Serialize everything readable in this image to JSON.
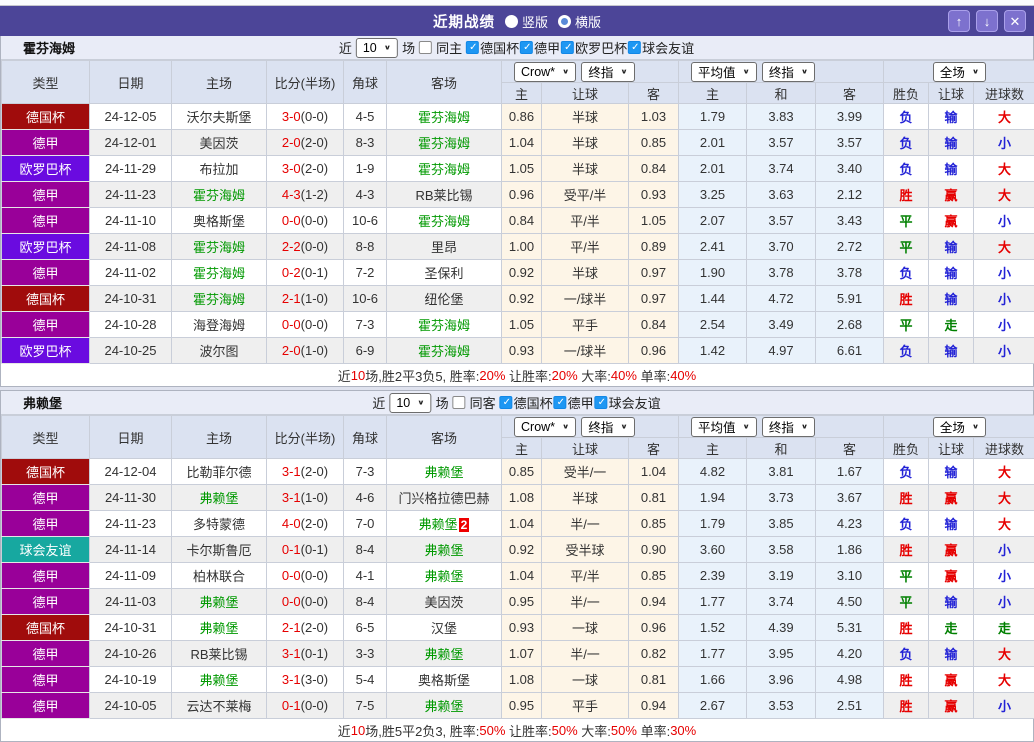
{
  "titlebar": {
    "title": "近期战绩",
    "radios": [
      {
        "label": "竖版",
        "style": "filled"
      },
      {
        "label": "横版",
        "style": "ring"
      }
    ],
    "buttons": [
      {
        "name": "scroll-up-button",
        "icon": "arrow-up-icon",
        "glyph": "↑"
      },
      {
        "name": "scroll-down-button",
        "icon": "arrow-down-icon",
        "glyph": "↓"
      },
      {
        "name": "close-button",
        "icon": "close-icon",
        "glyph": "✕"
      }
    ]
  },
  "colors": {
    "titlebar_bg": "#4c4598",
    "checkbox_blue": "#1e97f3",
    "team_green": "#009900",
    "score_red": "#e60000"
  },
  "league_colors": {
    "德国杯": "#a00c0c",
    "德甲": "#990099",
    "欧罗巴杯": "#6a0be0",
    "球会友谊": "#17a8a0"
  },
  "result_colors": {
    "r": "#e60000",
    "b": "#2323d6",
    "g": "#008000"
  },
  "table_header": {
    "cols": [
      "类型",
      "日期",
      "主场",
      "比分(半场)",
      "角球",
      "客场"
    ],
    "groups": [
      {
        "selects": [
          "Crow*",
          "终指"
        ],
        "subs": [
          "主",
          "让球",
          "客"
        ],
        "align": "left"
      },
      {
        "selects": [
          "平均值",
          "终指"
        ],
        "subs": [
          "主",
          "和",
          "客"
        ],
        "align": "left"
      },
      {
        "selects": [
          "全场"
        ],
        "subs": [
          "胜负",
          "让球",
          "进球数"
        ],
        "align": "center"
      }
    ]
  },
  "sections": [
    {
      "team": "霍芬海姆",
      "filter": {
        "near_label": "近",
        "count": "10",
        "games_label": "场",
        "same_label": "同主",
        "leagues": [
          "德国杯",
          "德甲",
          "欧罗巴杯",
          "球会友谊"
        ]
      },
      "rows": [
        {
          "league": "德国杯",
          "date": "24-12-05",
          "home": {
            "t": "沃尔夫斯堡",
            "green": false
          },
          "score": {
            "ft": "3-0",
            "ht": "(0-0)"
          },
          "corner": "4-5",
          "away": {
            "t": "霍芬海姆",
            "green": true
          },
          "odds": [
            "0.86",
            "半球",
            "1.03"
          ],
          "avg": [
            "1.79",
            "3.83",
            "3.99"
          ],
          "results": [
            {
              "t": "负",
              "c": "b"
            },
            {
              "t": "输",
              "c": "b"
            },
            {
              "t": "大",
              "c": "r"
            }
          ]
        },
        {
          "league": "德甲",
          "date": "24-12-01",
          "home": {
            "t": "美因茨",
            "green": false
          },
          "score": {
            "ft": "2-0",
            "ht": "(2-0)"
          },
          "corner": "8-3",
          "away": {
            "t": "霍芬海姆",
            "green": true
          },
          "odds": [
            "1.04",
            "半球",
            "0.85"
          ],
          "avg": [
            "2.01",
            "3.57",
            "3.57"
          ],
          "results": [
            {
              "t": "负",
              "c": "b"
            },
            {
              "t": "输",
              "c": "b"
            },
            {
              "t": "小",
              "c": "b"
            }
          ]
        },
        {
          "league": "欧罗巴杯",
          "date": "24-11-29",
          "home": {
            "t": "布拉加",
            "green": false
          },
          "score": {
            "ft": "3-0",
            "ht": "(2-0)"
          },
          "corner": "1-9",
          "away": {
            "t": "霍芬海姆",
            "green": true
          },
          "odds": [
            "1.05",
            "半球",
            "0.84"
          ],
          "avg": [
            "2.01",
            "3.74",
            "3.40"
          ],
          "results": [
            {
              "t": "负",
              "c": "b"
            },
            {
              "t": "输",
              "c": "b"
            },
            {
              "t": "大",
              "c": "r"
            }
          ]
        },
        {
          "league": "德甲",
          "date": "24-11-23",
          "home": {
            "t": "霍芬海姆",
            "green": true
          },
          "score": {
            "ft": "4-3",
            "ht": "(1-2)"
          },
          "corner": "4-3",
          "away": {
            "t": "RB莱比锡",
            "green": false
          },
          "odds": [
            "0.96",
            "受平/半",
            "0.93"
          ],
          "avg": [
            "3.25",
            "3.63",
            "2.12"
          ],
          "results": [
            {
              "t": "胜",
              "c": "r"
            },
            {
              "t": "赢",
              "c": "r"
            },
            {
              "t": "大",
              "c": "r"
            }
          ]
        },
        {
          "league": "德甲",
          "date": "24-11-10",
          "home": {
            "t": "奥格斯堡",
            "green": false
          },
          "score": {
            "ft": "0-0",
            "ht": "(0-0)"
          },
          "corner": "10-6",
          "away": {
            "t": "霍芬海姆",
            "green": true
          },
          "odds": [
            "0.84",
            "平/半",
            "1.05"
          ],
          "avg": [
            "2.07",
            "3.57",
            "3.43"
          ],
          "results": [
            {
              "t": "平",
              "c": "g"
            },
            {
              "t": "赢",
              "c": "r"
            },
            {
              "t": "小",
              "c": "b"
            }
          ]
        },
        {
          "league": "欧罗巴杯",
          "date": "24-11-08",
          "home": {
            "t": "霍芬海姆",
            "green": true
          },
          "score": {
            "ft": "2-2",
            "ht": "(0-0)"
          },
          "corner": "8-8",
          "away": {
            "t": "里昂",
            "green": false
          },
          "odds": [
            "1.00",
            "平/半",
            "0.89"
          ],
          "avg": [
            "2.41",
            "3.70",
            "2.72"
          ],
          "results": [
            {
              "t": "平",
              "c": "g"
            },
            {
              "t": "输",
              "c": "b"
            },
            {
              "t": "大",
              "c": "r"
            }
          ]
        },
        {
          "league": "德甲",
          "date": "24-11-02",
          "home": {
            "t": "霍芬海姆",
            "green": true
          },
          "score": {
            "ft": "0-2",
            "ht": "(0-1)"
          },
          "corner": "7-2",
          "away": {
            "t": "圣保利",
            "green": false
          },
          "odds": [
            "0.92",
            "半球",
            "0.97"
          ],
          "avg": [
            "1.90",
            "3.78",
            "3.78"
          ],
          "results": [
            {
              "t": "负",
              "c": "b"
            },
            {
              "t": "输",
              "c": "b"
            },
            {
              "t": "小",
              "c": "b"
            }
          ]
        },
        {
          "league": "德国杯",
          "date": "24-10-31",
          "home": {
            "t": "霍芬海姆",
            "green": true
          },
          "score": {
            "ft": "2-1",
            "ht": "(1-0)"
          },
          "corner": "10-6",
          "away": {
            "t": "纽伦堡",
            "green": false
          },
          "odds": [
            "0.92",
            "一/球半",
            "0.97"
          ],
          "avg": [
            "1.44",
            "4.72",
            "5.91"
          ],
          "results": [
            {
              "t": "胜",
              "c": "r"
            },
            {
              "t": "输",
              "c": "b"
            },
            {
              "t": "小",
              "c": "b"
            }
          ]
        },
        {
          "league": "德甲",
          "date": "24-10-28",
          "home": {
            "t": "海登海姆",
            "green": false
          },
          "score": {
            "ft": "0-0",
            "ht": "(0-0)"
          },
          "corner": "7-3",
          "away": {
            "t": "霍芬海姆",
            "green": true
          },
          "odds": [
            "1.05",
            "平手",
            "0.84"
          ],
          "avg": [
            "2.54",
            "3.49",
            "2.68"
          ],
          "results": [
            {
              "t": "平",
              "c": "g"
            },
            {
              "t": "走",
              "c": "g"
            },
            {
              "t": "小",
              "c": "b"
            }
          ]
        },
        {
          "league": "欧罗巴杯",
          "date": "24-10-25",
          "home": {
            "t": "波尔图",
            "green": false
          },
          "score": {
            "ft": "2-0",
            "ht": "(1-0)"
          },
          "corner": "6-9",
          "away": {
            "t": "霍芬海姆",
            "green": true
          },
          "odds": [
            "0.93",
            "一/球半",
            "0.96"
          ],
          "avg": [
            "1.42",
            "4.97",
            "6.61"
          ],
          "results": [
            {
              "t": "负",
              "c": "b"
            },
            {
              "t": "输",
              "c": "b"
            },
            {
              "t": "小",
              "c": "b"
            }
          ]
        }
      ],
      "summary": [
        {
          "t": "近",
          "red": false
        },
        {
          "t": "10",
          "red": true
        },
        {
          "t": "场,胜2平3负5, 胜率:",
          "red": false
        },
        {
          "t": "20%",
          "red": true
        },
        {
          "t": " 让胜率:",
          "red": false
        },
        {
          "t": "20%",
          "red": true
        },
        {
          "t": " 大率:",
          "red": false
        },
        {
          "t": "40%",
          "red": true
        },
        {
          "t": " 单率:",
          "red": false
        },
        {
          "t": "40%",
          "red": true
        }
      ]
    },
    {
      "team": "弗赖堡",
      "filter": {
        "near_label": "近",
        "count": "10",
        "games_label": "场",
        "same_label": "同客",
        "leagues": [
          "德国杯",
          "德甲",
          "球会友谊"
        ]
      },
      "rows": [
        {
          "league": "德国杯",
          "date": "24-12-04",
          "home": {
            "t": "比勒菲尔德",
            "green": false
          },
          "score": {
            "ft": "3-1",
            "ht": "(2-0)"
          },
          "corner": "7-3",
          "away": {
            "t": "弗赖堡",
            "green": true
          },
          "odds": [
            "0.85",
            "受半/一",
            "1.04"
          ],
          "avg": [
            "4.82",
            "3.81",
            "1.67"
          ],
          "results": [
            {
              "t": "负",
              "c": "b"
            },
            {
              "t": "输",
              "c": "b"
            },
            {
              "t": "大",
              "c": "r"
            }
          ]
        },
        {
          "league": "德甲",
          "date": "24-11-30",
          "home": {
            "t": "弗赖堡",
            "green": true
          },
          "score": {
            "ft": "3-1",
            "ht": "(1-0)"
          },
          "corner": "4-6",
          "away": {
            "t": "门兴格拉德巴赫",
            "green": false
          },
          "odds": [
            "1.08",
            "半球",
            "0.81"
          ],
          "avg": [
            "1.94",
            "3.73",
            "3.67"
          ],
          "results": [
            {
              "t": "胜",
              "c": "r"
            },
            {
              "t": "赢",
              "c": "r"
            },
            {
              "t": "大",
              "c": "r"
            }
          ]
        },
        {
          "league": "德甲",
          "date": "24-11-23",
          "home": {
            "t": "多特蒙德",
            "green": false
          },
          "score": {
            "ft": "4-0",
            "ht": "(2-0)"
          },
          "corner": "7-0",
          "away": {
            "t": "弗赖堡",
            "green": true,
            "badge": "2"
          },
          "odds": [
            "1.04",
            "半/一",
            "0.85"
          ],
          "avg": [
            "1.79",
            "3.85",
            "4.23"
          ],
          "results": [
            {
              "t": "负",
              "c": "b"
            },
            {
              "t": "输",
              "c": "b"
            },
            {
              "t": "大",
              "c": "r"
            }
          ]
        },
        {
          "league": "球会友谊",
          "date": "24-11-14",
          "home": {
            "t": "卡尔斯鲁厄",
            "green": false
          },
          "score": {
            "ft": "0-1",
            "ht": "(0-1)"
          },
          "corner": "8-4",
          "away": {
            "t": "弗赖堡",
            "green": true
          },
          "odds": [
            "0.92",
            "受半球",
            "0.90"
          ],
          "avg": [
            "3.60",
            "3.58",
            "1.86"
          ],
          "results": [
            {
              "t": "胜",
              "c": "r"
            },
            {
              "t": "赢",
              "c": "r"
            },
            {
              "t": "小",
              "c": "b"
            }
          ]
        },
        {
          "league": "德甲",
          "date": "24-11-09",
          "home": {
            "t": "柏林联合",
            "green": false
          },
          "score": {
            "ft": "0-0",
            "ht": "(0-0)"
          },
          "corner": "4-1",
          "away": {
            "t": "弗赖堡",
            "green": true
          },
          "odds": [
            "1.04",
            "平/半",
            "0.85"
          ],
          "avg": [
            "2.39",
            "3.19",
            "3.10"
          ],
          "results": [
            {
              "t": "平",
              "c": "g"
            },
            {
              "t": "赢",
              "c": "r"
            },
            {
              "t": "小",
              "c": "b"
            }
          ]
        },
        {
          "league": "德甲",
          "date": "24-11-03",
          "home": {
            "t": "弗赖堡",
            "green": true
          },
          "score": {
            "ft": "0-0",
            "ht": "(0-0)"
          },
          "corner": "8-4",
          "away": {
            "t": "美因茨",
            "green": false
          },
          "odds": [
            "0.95",
            "半/一",
            "0.94"
          ],
          "avg": [
            "1.77",
            "3.74",
            "4.50"
          ],
          "results": [
            {
              "t": "平",
              "c": "g"
            },
            {
              "t": "输",
              "c": "b"
            },
            {
              "t": "小",
              "c": "b"
            }
          ]
        },
        {
          "league": "德国杯",
          "date": "24-10-31",
          "home": {
            "t": "弗赖堡",
            "green": true
          },
          "score": {
            "ft": "2-1",
            "ht": "(2-0)"
          },
          "corner": "6-5",
          "away": {
            "t": "汉堡",
            "green": false
          },
          "odds": [
            "0.93",
            "一球",
            "0.96"
          ],
          "avg": [
            "1.52",
            "4.39",
            "5.31"
          ],
          "results": [
            {
              "t": "胜",
              "c": "r"
            },
            {
              "t": "走",
              "c": "g"
            },
            {
              "t": "走",
              "c": "g"
            }
          ]
        },
        {
          "league": "德甲",
          "date": "24-10-26",
          "home": {
            "t": "RB莱比锡",
            "green": false
          },
          "score": {
            "ft": "3-1",
            "ht": "(0-1)"
          },
          "corner": "3-3",
          "away": {
            "t": "弗赖堡",
            "green": true
          },
          "odds": [
            "1.07",
            "半/一",
            "0.82"
          ],
          "avg": [
            "1.77",
            "3.95",
            "4.20"
          ],
          "results": [
            {
              "t": "负",
              "c": "b"
            },
            {
              "t": "输",
              "c": "b"
            },
            {
              "t": "大",
              "c": "r"
            }
          ]
        },
        {
          "league": "德甲",
          "date": "24-10-19",
          "home": {
            "t": "弗赖堡",
            "green": true
          },
          "score": {
            "ft": "3-1",
            "ht": "(3-0)"
          },
          "corner": "5-4",
          "away": {
            "t": "奥格斯堡",
            "green": false
          },
          "odds": [
            "1.08",
            "一球",
            "0.81"
          ],
          "avg": [
            "1.66",
            "3.96",
            "4.98"
          ],
          "results": [
            {
              "t": "胜",
              "c": "r"
            },
            {
              "t": "赢",
              "c": "r"
            },
            {
              "t": "大",
              "c": "r"
            }
          ]
        },
        {
          "league": "德甲",
          "date": "24-10-05",
          "home": {
            "t": "云达不莱梅",
            "green": false
          },
          "score": {
            "ft": "0-1",
            "ht": "(0-0)"
          },
          "corner": "7-5",
          "away": {
            "t": "弗赖堡",
            "green": true
          },
          "odds": [
            "0.95",
            "平手",
            "0.94"
          ],
          "avg": [
            "2.67",
            "3.53",
            "2.51"
          ],
          "results": [
            {
              "t": "胜",
              "c": "r"
            },
            {
              "t": "赢",
              "c": "r"
            },
            {
              "t": "小",
              "c": "b"
            }
          ]
        }
      ],
      "summary": [
        {
          "t": "近",
          "red": false
        },
        {
          "t": "10",
          "red": true
        },
        {
          "t": "场,胜5平2负3, 胜率:",
          "red": false
        },
        {
          "t": "50%",
          "red": true
        },
        {
          "t": " 让胜率:",
          "red": false
        },
        {
          "t": "50%",
          "red": true
        },
        {
          "t": " 大率:",
          "red": false
        },
        {
          "t": "50%",
          "red": true
        },
        {
          "t": " 单率:",
          "red": false
        },
        {
          "t": "30%",
          "red": true
        }
      ]
    }
  ]
}
